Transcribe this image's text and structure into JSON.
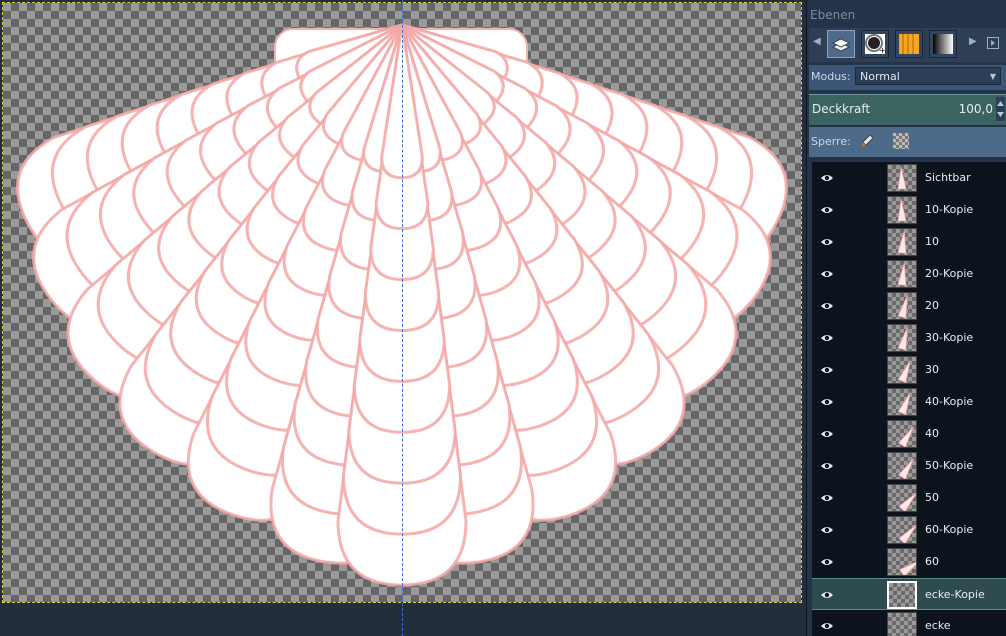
{
  "panel": {
    "title": "Ebenen",
    "tabs": [
      {
        "name": "layers-tab-icon",
        "active": true
      },
      {
        "name": "brush-tab-icon",
        "active": false
      },
      {
        "name": "pattern-tab-icon",
        "active": false
      },
      {
        "name": "gradient-tab-icon",
        "active": false
      }
    ],
    "mode_label": "Modus:",
    "mode_value": "Normal",
    "opacity_label": "Deckkraft",
    "opacity_value": "100,0",
    "lock_label": "Sperre:"
  },
  "layers": [
    {
      "name": "Sichtbar",
      "visible": true,
      "selected": false
    },
    {
      "name": "10-Kopie",
      "visible": true,
      "selected": false
    },
    {
      "name": "10",
      "visible": true,
      "selected": false
    },
    {
      "name": "20-Kopie",
      "visible": true,
      "selected": false
    },
    {
      "name": "20",
      "visible": true,
      "selected": false
    },
    {
      "name": "30-Kopie",
      "visible": true,
      "selected": false
    },
    {
      "name": "30",
      "visible": true,
      "selected": false
    },
    {
      "name": "40-Kopie",
      "visible": true,
      "selected": false
    },
    {
      "name": "40",
      "visible": true,
      "selected": false
    },
    {
      "name": "50-Kopie",
      "visible": true,
      "selected": false
    },
    {
      "name": "50",
      "visible": true,
      "selected": false
    },
    {
      "name": "60-Kopie",
      "visible": true,
      "selected": false
    },
    {
      "name": "60",
      "visible": true,
      "selected": false
    },
    {
      "name": "ecke-Kopie",
      "visible": true,
      "selected": true
    },
    {
      "name": "ecke",
      "visible": true,
      "selected": false
    }
  ],
  "colors": {
    "shell_fill": "#ffffff",
    "shell_edge": "#f2a7a6",
    "guide": "#3a6bd8",
    "selection_border": "#d4d43c"
  }
}
